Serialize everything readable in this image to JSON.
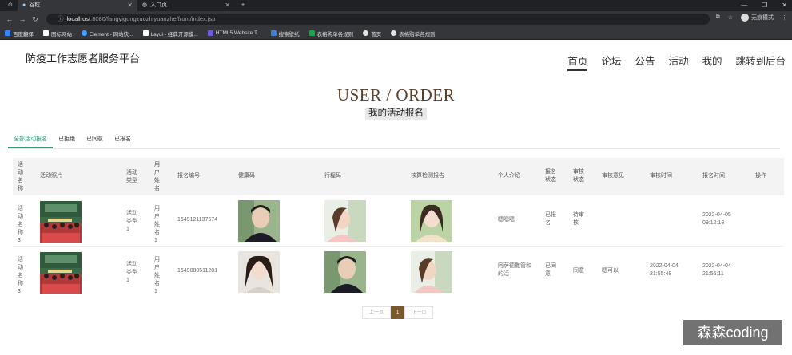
{
  "browser": {
    "tabs": [
      {
        "label": "谷粒",
        "active": true
      },
      {
        "label": "入口页",
        "active": false
      }
    ],
    "url": {
      "host": "localhost",
      "rest": ":8080/fangyigongzuozhiyuanzhe/front/index.jsp"
    },
    "profile_label": "无痕模式",
    "bookmarks": [
      {
        "label": "百度翻译",
        "color": "#3b82f6"
      },
      {
        "label": "图标网站",
        "color": "#ffffff"
      },
      {
        "label": "Element - 网站快...",
        "color": "#409eff"
      },
      {
        "label": "Layui - 经典开源模...",
        "color": "#ffffff"
      },
      {
        "label": "HTML5 Website T...",
        "color": "#6b5bd6"
      },
      {
        "label": "搜索壁纸",
        "color": "#3f7fd6"
      },
      {
        "label": "表格购单各规则",
        "color": "#16a34a"
      },
      {
        "label": "首页",
        "color": "#e5e5e5"
      },
      {
        "label": "表格购单各规则",
        "color": "#e5e5e5"
      }
    ]
  },
  "header": {
    "title": "防疫工作志愿者服务平台",
    "nav": [
      {
        "label": "首页",
        "active": true
      },
      {
        "label": "论坛",
        "active": false
      },
      {
        "label": "公告",
        "active": false
      },
      {
        "label": "活动",
        "active": false
      },
      {
        "label": "我的",
        "active": false
      },
      {
        "label": "跳转到后台",
        "active": false
      }
    ]
  },
  "banner": {
    "en": "USER / ORDER",
    "cn": "我的活动报名"
  },
  "filter_tabs": [
    {
      "label": "全部活动报名",
      "active": true
    },
    {
      "label": "已拒绝",
      "active": false
    },
    {
      "label": "已同意",
      "active": false
    },
    {
      "label": "已报名",
      "active": false
    }
  ],
  "table": {
    "columns": [
      "活动名称",
      "活动照片",
      "活动类型",
      "用户姓名",
      "报名编号",
      "健康码",
      "行程码",
      "核算检测报告",
      "个人介绍",
      "报名状态",
      "审核状态",
      "审核意见",
      "审核时间",
      "报名时间",
      "操作"
    ],
    "rows": [
      {
        "activity_name": "活动名称3",
        "activity_type": "活动类型1",
        "user_name": "用户姓名1",
        "order_no": "1649121137574",
        "intro": "嗯嗯嗯",
        "order_status": "已报名",
        "review_status": "待审核",
        "review_opinion": "",
        "review_time": "",
        "order_time": "2022-04-05 09:12:18",
        "health_photo": "male",
        "trip_photo": "female-side",
        "test_photo": "female-front"
      },
      {
        "activity_name": "活动名称3",
        "activity_type": "活动类型1",
        "user_name": "用户姓名1",
        "order_no": "1649080511281",
        "intro": "阿萨德撒管和的活",
        "order_status": "已同意",
        "review_status": "同意",
        "review_opinion": "嗯可以",
        "review_time": "2022-04-04 21:55:48",
        "order_time": "2022-04-04 21:55:11",
        "health_photo": "female-front",
        "trip_photo": "male",
        "test_photo": "female-side"
      }
    ]
  },
  "pagination": {
    "prev": "上一页",
    "current": "1",
    "next": "下一页"
  },
  "watermark": "森森coding"
}
